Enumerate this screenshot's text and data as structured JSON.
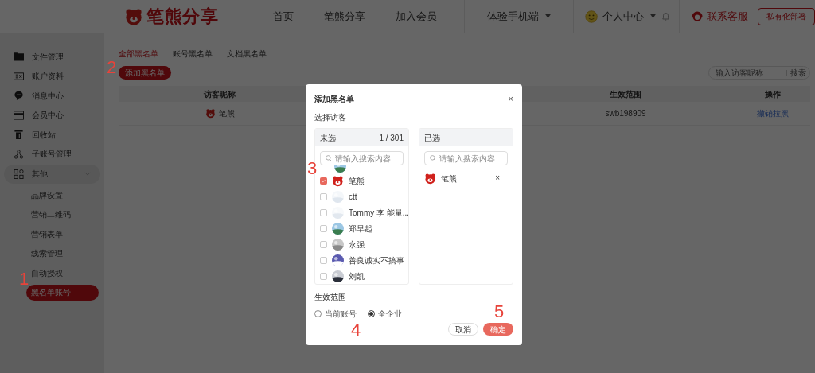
{
  "header": {
    "brand": "笔熊分享",
    "nav": [
      {
        "label": "首页"
      },
      {
        "label": "笔熊分享"
      },
      {
        "label": "加入会员"
      }
    ],
    "mobile": "体验手机端",
    "user": "个人中心",
    "support": "联系客服",
    "deploy_button": "私有化部署"
  },
  "sidebar": {
    "items": [
      {
        "label": "文件管理"
      },
      {
        "label": "账户资料"
      },
      {
        "label": "消息中心"
      },
      {
        "label": "会员中心"
      },
      {
        "label": "回收站"
      },
      {
        "label": "子账号管理"
      },
      {
        "label": "其他",
        "expanded": true,
        "children": [
          {
            "label": "品牌设置",
            "selected": false
          },
          {
            "label": "营销二维码",
            "selected": false
          },
          {
            "label": "营销表单",
            "selected": false
          },
          {
            "label": "线索管理",
            "selected": false
          },
          {
            "label": "自动授权",
            "selected": false
          },
          {
            "label": "黑名单账号",
            "selected": true
          }
        ]
      }
    ]
  },
  "tabs": [
    {
      "label": "全部黑名单",
      "selected": true
    },
    {
      "label": "账号黑名单",
      "selected": false
    },
    {
      "label": "文档黑名单",
      "selected": false
    }
  ],
  "add_button": "添加黑名单",
  "search": {
    "placeholder": "输入访客昵称",
    "button": "搜索"
  },
  "table": {
    "columns": [
      {
        "label": "访客昵称"
      },
      {
        "label": "生效范围"
      },
      {
        "label": "操作"
      }
    ],
    "rows": [
      {
        "nickname": "笔熊",
        "scope": "swb198909",
        "action": "撤销拉黑"
      }
    ]
  },
  "dialog": {
    "title": "添加黑名单",
    "close": "×",
    "section": "选择访客",
    "available": {
      "title": "未选",
      "count": "1 / 301",
      "placeholder": "请输入搜索内容",
      "items": [
        {
          "name": "笔熊",
          "kind": "brand",
          "checked": true
        },
        {
          "name": "ctt",
          "checked": false
        },
        {
          "name": "Tommy 李 能量...",
          "checked": false
        },
        {
          "name": "郑早起",
          "checked": false
        },
        {
          "name": "永强",
          "checked": false
        },
        {
          "name": "善良诚实不搞事",
          "checked": false
        },
        {
          "name": "刘凯",
          "checked": false
        }
      ]
    },
    "chosen": {
      "title": "已选",
      "placeholder": "请输入搜索内容",
      "items": [
        {
          "name": "笔熊",
          "kind": "brand",
          "remove": "×"
        }
      ]
    },
    "scope_label": "生效范围",
    "scope_options": [
      {
        "label": "当前账号",
        "selected": false
      },
      {
        "label": "全企业",
        "selected": true
      }
    ],
    "cancel": "取消",
    "confirm": "确定"
  },
  "annotations": [
    "1",
    "2",
    "3",
    "4",
    "5"
  ]
}
